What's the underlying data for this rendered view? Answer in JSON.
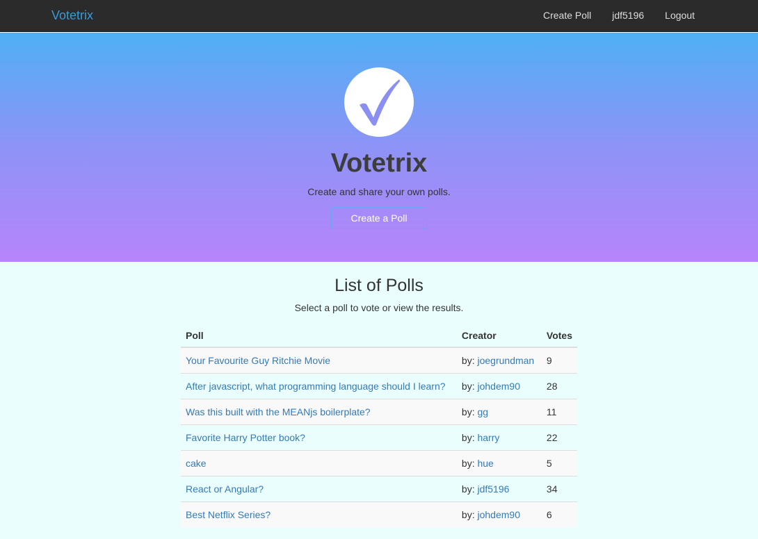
{
  "nav": {
    "brand": "Votetrix",
    "links": [
      "Create Poll",
      "jdf5196",
      "Logout"
    ]
  },
  "hero": {
    "title": "Votetrix",
    "subtitle": "Create and share your own polls.",
    "button": "Create a Poll",
    "logo_icon": "checkmark-icon"
  },
  "list": {
    "title": "List of Polls",
    "subtitle": "Select a poll to vote or view the results.",
    "headers": [
      "Poll",
      "Creator",
      "Votes"
    ],
    "creator_prefix": "by:",
    "rows": [
      {
        "poll": "Your Favourite Guy Ritchie Movie",
        "creator": "joegrundman",
        "votes": "9"
      },
      {
        "poll": "After javascript, what programming language should I learn?",
        "creator": "johdem90",
        "votes": "28"
      },
      {
        "poll": "Was this built with the MEANjs boilerplate?",
        "creator": "gg",
        "votes": "11"
      },
      {
        "poll": "Favorite Harry Potter book?",
        "creator": "harry",
        "votes": "22"
      },
      {
        "poll": "cake",
        "creator": "hue",
        "votes": "5"
      },
      {
        "poll": "React or Angular?",
        "creator": "jdf5196",
        "votes": "34"
      },
      {
        "poll": "Best Netflix Series?",
        "creator": "johdem90",
        "votes": "6"
      }
    ]
  },
  "colors": {
    "navbar": "#2b2b2b",
    "brand": "#3a9ad9",
    "gradient_top": "#4fb0f5",
    "gradient_bottom": "#b784fb",
    "link": "#337ab7",
    "page_bg": "#eafffd"
  }
}
